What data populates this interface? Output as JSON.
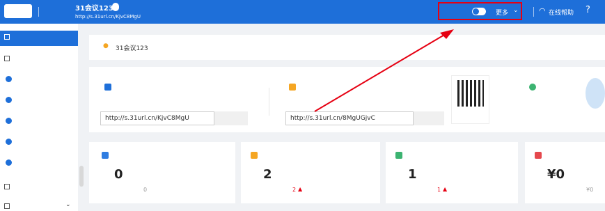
{
  "header": {
    "logo": "",
    "back": "",
    "title": "31会议123",
    "badge": "",
    "url": "http://s.31url.cn/KjvC8MgU",
    "preview": "",
    "qr_link": "",
    "publish": "",
    "more": "更多",
    "help": "在线帮助"
  },
  "sidebar": {
    "items": [
      {
        "label": ""
      },
      {
        "label": ""
      },
      {
        "label": ""
      },
      {
        "label": ""
      },
      {
        "label": ""
      },
      {
        "label": ""
      },
      {
        "label": ""
      },
      {
        "label": ""
      },
      {
        "label": ""
      }
    ]
  },
  "notice": {
    "text": "31会议123"
  },
  "site": {
    "title": "",
    "url": "http://s.31url.cn/KjvC8MgU",
    "copy": ""
  },
  "wechat": {
    "title": "",
    "url": "http://s.31url.cn/8MgUGjvC",
    "copy": "",
    "qr_label": ""
  },
  "mini": {
    "title": "",
    "label": ""
  },
  "stats": [
    {
      "label": "",
      "value": "0",
      "today": "",
      "today_num": "0",
      "color": "#2f7de1"
    },
    {
      "label": "",
      "value": "2",
      "today": "",
      "today_num": "2",
      "color": "#f5a623"
    },
    {
      "label": "",
      "value": "1",
      "today": "",
      "today_num": "1",
      "color": "#3cb371"
    },
    {
      "label": "",
      "value": "¥0",
      "today": "",
      "today_num": "¥0",
      "color": "#e5484d"
    }
  ],
  "colors": {
    "primary": "#1e6fd9",
    "highlight": "#e60012",
    "up": "#e60012"
  }
}
